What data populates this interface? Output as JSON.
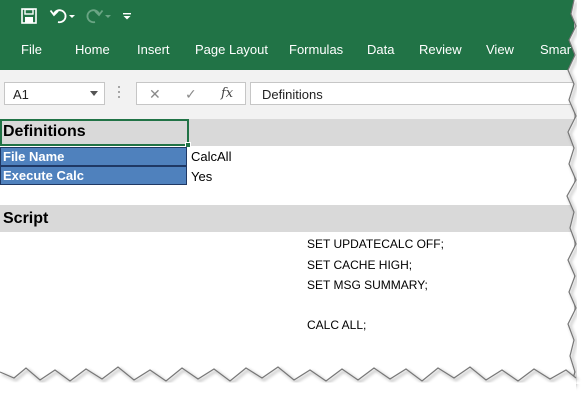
{
  "quick_access": {
    "save_icon": "save-icon",
    "undo_icon": "undo-icon",
    "redo_icon": "redo-icon",
    "customize_icon": "customize-qat-icon"
  },
  "ribbon": {
    "tabs": [
      "File",
      "Home",
      "Insert",
      "Page Layout",
      "Formulas",
      "Data",
      "Review",
      "View",
      "Smar"
    ]
  },
  "formula_bar": {
    "name_box": "A1",
    "cancel_glyph": "✕",
    "enter_glyph": "✓",
    "fx_glyph": "fx",
    "content": "Definitions"
  },
  "sheet": {
    "definitions_header": "Definitions",
    "rows": [
      {
        "label": "File Name",
        "value": "CalcAll"
      },
      {
        "label": "Execute Calc",
        "value": "Yes"
      }
    ],
    "script_header": "Script",
    "script_lines": [
      "SET UPDATECALC OFF;",
      "SET CACHE HIGH;",
      "SET MSG SUMMARY;",
      "",
      "CALC ALL;"
    ]
  },
  "colors": {
    "ribbon_green": "#217346",
    "label_blue": "#4f81bd",
    "header_gray": "#d9d9d9"
  }
}
